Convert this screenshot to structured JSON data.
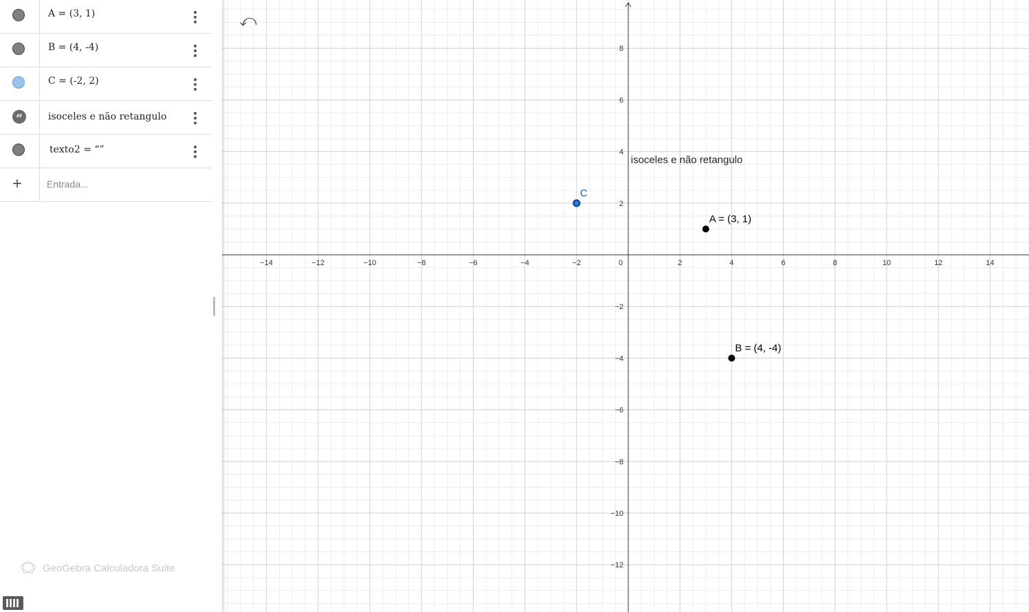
{
  "algebra": {
    "items": [
      {
        "label": "A = (3, 1)",
        "color": "#808080"
      },
      {
        "label": "B = (4, -4)",
        "color": "#808080"
      },
      {
        "label": "C = (-2, 2)",
        "color": "#99c2ee"
      },
      {
        "label": "isoceles e não retangulo",
        "color": "#6b6b6b",
        "icon": "quote-icon"
      },
      {
        "label": "texto2  =  “”",
        "color": "#808080"
      }
    ],
    "input_placeholder": "Entrada..."
  },
  "branding": "GeoGebra Calculadora Suite",
  "graphics": {
    "x_ticks": [
      "−14",
      "−12",
      "−10",
      "−8",
      "−6",
      "−4",
      "−2",
      "0",
      "2",
      "4",
      "6",
      "8",
      "10",
      "12",
      "14"
    ],
    "y_ticks": [
      "8",
      "6",
      "4",
      "2",
      "−2",
      "−4",
      "−6",
      "−8",
      "−10",
      "−12"
    ],
    "points": [
      {
        "name": "A",
        "x": 3,
        "y": 1,
        "label": "A = (3, 1)",
        "color": "#000000"
      },
      {
        "name": "B",
        "x": 4,
        "y": -4,
        "label": "B = (4, -4)",
        "color": "#000000"
      },
      {
        "name": "C",
        "x": -2,
        "y": 2,
        "label": "C",
        "color": "#1565c0"
      }
    ],
    "text": "isoceles e não retangulo"
  }
}
